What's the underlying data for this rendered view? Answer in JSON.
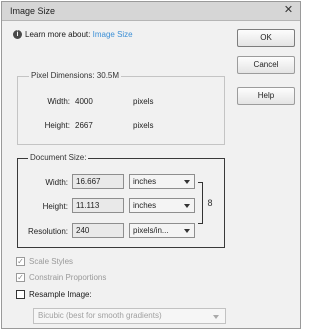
{
  "window": {
    "title": "Image Size"
  },
  "learn": {
    "prefix": "Learn more about:",
    "link": "Image Size"
  },
  "buttons": {
    "ok": "OK",
    "cancel": "Cancel",
    "help": "Help"
  },
  "pixel_dimensions": {
    "label": "Pixel Dimensions: 30.5M",
    "width_label": "Width:",
    "width_value": "4000",
    "width_unit": "pixels",
    "height_label": "Height:",
    "height_value": "2667",
    "height_unit": "pixels"
  },
  "document_size": {
    "label": "Document Size:",
    "width_label": "Width:",
    "width_value": "16.667",
    "width_unit": "inches",
    "height_label": "Height:",
    "height_value": "11.113",
    "height_unit": "inches",
    "resolution_label": "Resolution:",
    "resolution_value": "240",
    "resolution_unit": "pixels/in..."
  },
  "options": {
    "scale_styles": {
      "label": "Scale Styles",
      "checked": true,
      "enabled": false
    },
    "constrain_proportions": {
      "label": "Constrain Proportions",
      "checked": true,
      "enabled": false
    },
    "resample_image": {
      "label": "Resample Image:",
      "checked": false,
      "enabled": true
    },
    "resample_method": "Bicubic (best for smooth gradients)"
  },
  "colors": {
    "link": "#3b8fd6",
    "dialog_bg": "#f1f1f1",
    "titlebar_bg": "#d6d6d6"
  }
}
